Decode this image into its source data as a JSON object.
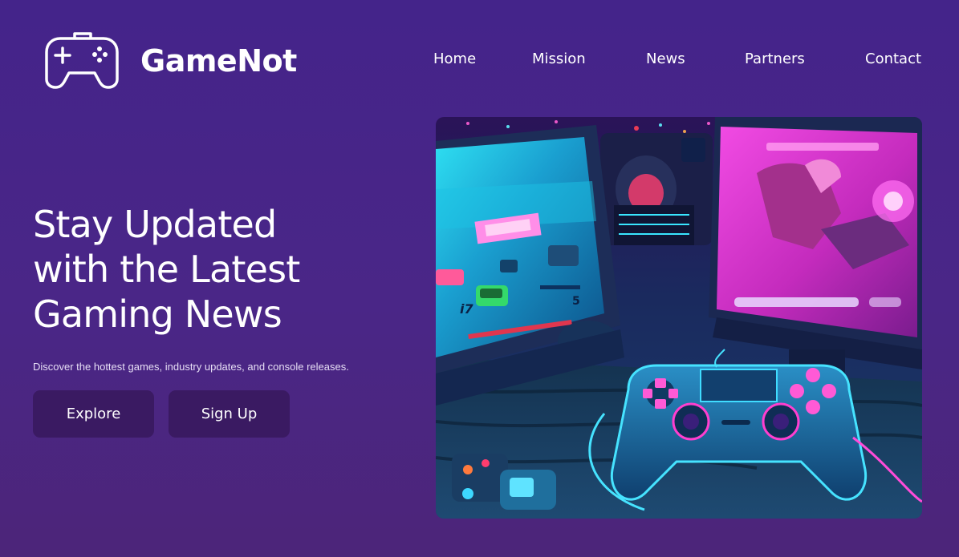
{
  "brand": {
    "name": "GameNot",
    "icon": "gamepad-icon"
  },
  "nav": {
    "items": [
      {
        "label": "Home"
      },
      {
        "label": "Mission"
      },
      {
        "label": "News"
      },
      {
        "label": "Partners"
      },
      {
        "label": "Contact"
      }
    ]
  },
  "hero": {
    "title_line1": "Stay Updated",
    "title_line2": "with the Latest",
    "title_line3": "Gaming News",
    "subtitle": "Discover the hottest games, industry updates, and console releases.",
    "buttons": {
      "explore": "Explore",
      "signup": "Sign Up"
    },
    "image": {
      "alt": "neon gaming setup illustration"
    }
  },
  "colors": {
    "background": "#44248a",
    "button": "#3a1a62",
    "text": "#ffffff",
    "neon_cyan": "#27d4f0",
    "neon_magenta": "#ee2fd9"
  }
}
